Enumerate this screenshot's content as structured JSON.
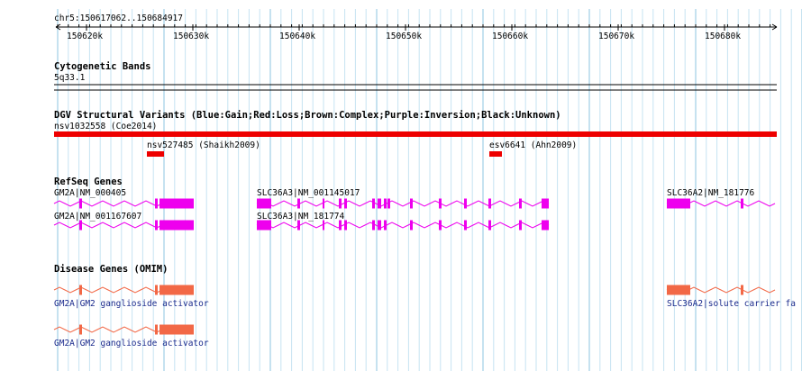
{
  "ruler": {
    "location": "chr5:150617062..150684917",
    "ticks": [
      "150620k",
      "150630k",
      "150640k",
      "150650k",
      "150660k",
      "150670k",
      "150680k"
    ]
  },
  "tracks": {
    "cytoband": {
      "title": "Cytogenetic Bands",
      "band": "5q33.1"
    },
    "dgv": {
      "title": "DGV Structural Variants (Blue:Gain;Red:Loss;Brown:Complex;Purple:Inversion;Black:Unknown)",
      "colors": {
        "loss": "#ee0000"
      },
      "variants": [
        {
          "label": "nsv1032558 (Coe2014)"
        },
        {
          "label": "nsv527485 (Shaikh2009)"
        },
        {
          "label": "esv6641 (Ahn2009)"
        }
      ]
    },
    "refseq": {
      "title": "RefSeq Genes",
      "color": "#ee00ee",
      "genes": [
        {
          "label": "GM2A|NM_000405"
        },
        {
          "label": "GM2A|NM_001167607"
        },
        {
          "label": "SLC36A3|NM_001145017"
        },
        {
          "label": "SLC36A3|NM_181774"
        },
        {
          "label": "SLC36A2|NM_181776"
        }
      ]
    },
    "omim": {
      "title": "Disease Genes (OMIM)",
      "color": "#f26846",
      "genes": [
        {
          "label": "GM2A|GM2 ganglioside activator"
        },
        {
          "label": "GM2A|GM2 ganglioside activator"
        },
        {
          "label": "SLC36A2|solute carrier fa"
        }
      ]
    }
  }
}
